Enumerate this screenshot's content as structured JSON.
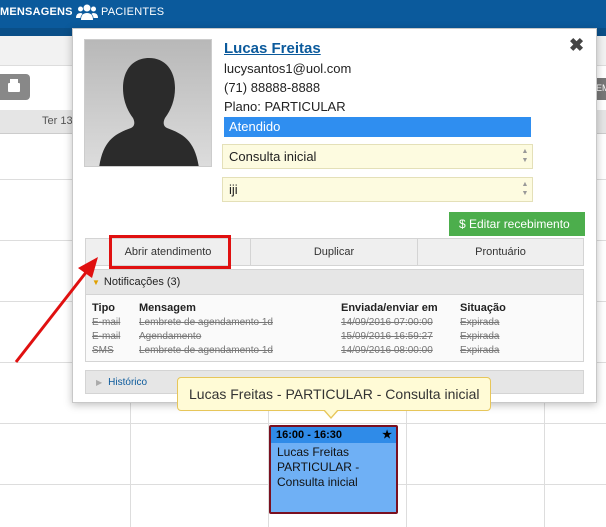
{
  "nav": {
    "messages_label": "MENSAGENS",
    "patients_label": "PACIENTES"
  },
  "calendar": {
    "day_label": "Ter 13",
    "right_button_label": "EM"
  },
  "popup": {
    "patient_name": "Lucas Freitas",
    "email": "lucysantos1@uol.com",
    "phone": "(71) 88888-8888",
    "plan": "Plano: PARTICULAR",
    "status": "Atendido",
    "appointment_type": "Consulta inicial",
    "notes": "iji",
    "close_symbol": "✖",
    "edit_payment_label": "$ Editar recebimento",
    "actions": {
      "open": "Abrir atendimento",
      "duplicate": "Duplicar",
      "record": "Prontuário"
    },
    "notifications": {
      "title": "Notificações (3)",
      "headers": [
        "Tipo",
        "Mensagem",
        "Enviada/enviar em",
        "Situação"
      ],
      "rows": [
        {
          "type": "E-mail",
          "message": "Lembrete de agendamento 1d",
          "date": "14/09/2016 07:00:00",
          "status": "Expirada"
        },
        {
          "type": "E-mail",
          "message": "Agendamento",
          "date": "15/09/2016 16:59:27",
          "status": "Expirada"
        },
        {
          "type": "SMS",
          "message": "Lembrete de agendamento 1d",
          "date": "14/09/2016 08:00:00",
          "status": "Expirada"
        }
      ]
    },
    "history_label": "Histórico"
  },
  "tooltip": {
    "text": "Lucas Freitas - PARTICULAR - Consulta inicial"
  },
  "event": {
    "time": "16:00 - 16:30",
    "star": "★",
    "line1": "Lucas Freitas",
    "line2": "PARTICULAR -",
    "line3": "Consulta inicial"
  },
  "colors": {
    "nav_bg": "#0b5a9c",
    "status_bg": "#2f8ef0",
    "edit_button": "#4cae4c",
    "highlight_box": "#e01010",
    "event_bg": "#6fb0f5",
    "event_border": "#7a1020"
  }
}
